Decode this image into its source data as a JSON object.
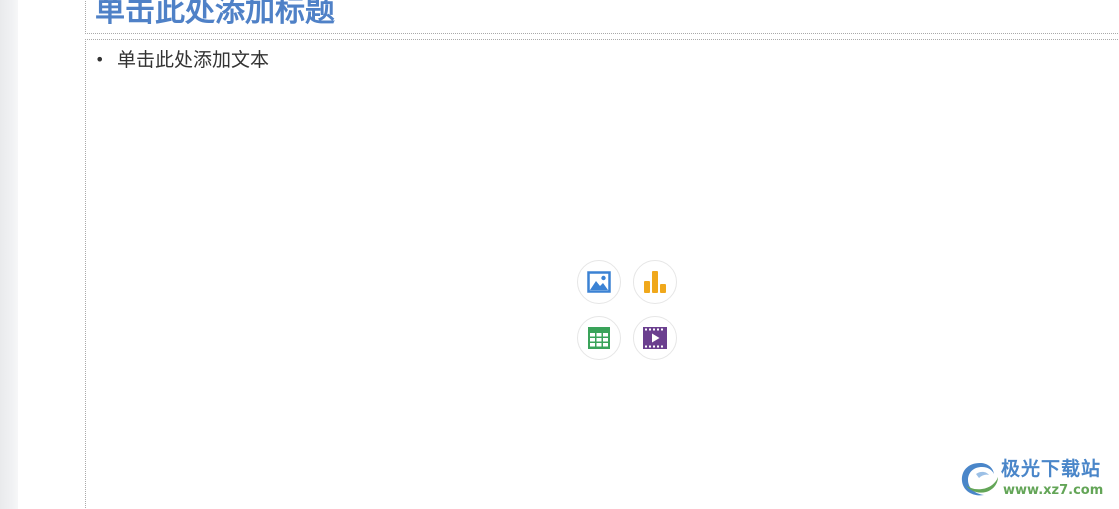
{
  "slide": {
    "title_placeholder": "单击此处添加标题",
    "body_placeholder": "单击此处添加文本",
    "bullet": "•"
  },
  "insert_buttons": {
    "picture": {
      "icon": "picture-icon",
      "color": "#3b82d4"
    },
    "chart": {
      "icon": "bar-chart-icon",
      "color": "#f0a81c"
    },
    "table": {
      "icon": "table-icon",
      "color": "#3aa35a"
    },
    "video": {
      "icon": "video-icon",
      "color": "#6b3f8f"
    }
  },
  "watermark": {
    "name": "极光下载站",
    "url": "www.xz7.com",
    "colors": {
      "name": "#4a86c9",
      "url": "#63a557"
    }
  }
}
